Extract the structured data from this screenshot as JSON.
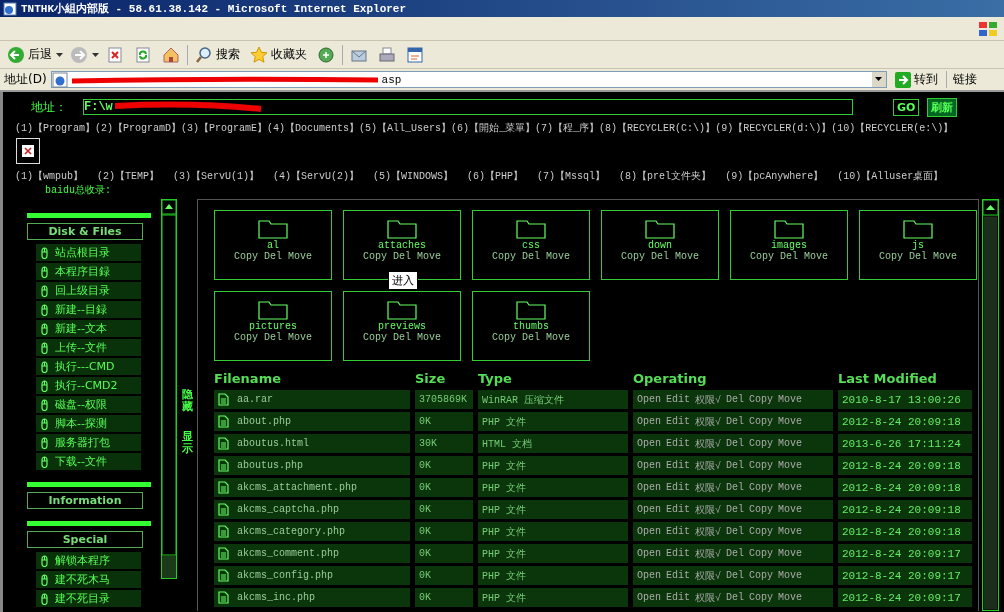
{
  "window": {
    "title": "TNTHK小組内部版 - 58.61.38.142 - Microsoft Internet Explorer"
  },
  "toolbar": [
    {
      "kind": "back",
      "label": "后退"
    },
    {
      "kind": "caret"
    },
    {
      "kind": "forward"
    },
    {
      "kind": "caret"
    },
    {
      "kind": "stop"
    },
    {
      "kind": "refresh"
    },
    {
      "kind": "home"
    },
    {
      "kind": "sep"
    },
    {
      "kind": "search",
      "label": "搜索"
    },
    {
      "kind": "favorites",
      "label": "收藏夹"
    },
    {
      "kind": "media"
    },
    {
      "kind": "sep"
    },
    {
      "kind": "mail"
    },
    {
      "kind": "print"
    },
    {
      "kind": "edit"
    }
  ],
  "address_bar": {
    "label": "地址(D)",
    "url": "asp",
    "go": "转到",
    "links": "链接"
  },
  "shell": {
    "path_label": "地址：",
    "path": "F:\\w",
    "go": "GO",
    "refresh": "刷新"
  },
  "quick_links": [
    "(1)【Program】",
    "(2)【ProgramD】",
    "(3)【ProgramE】",
    "(4)【Documents】",
    "(5)【All_Users】",
    "(6)【開始_菜單】",
    "(7)【程_序】",
    "(8)【RECYCLER(C:\\)】",
    "(9)【RECYCLER(d:\\)】",
    "(10)【RECYCLER(e:\\)】"
  ],
  "quick_links_2": [
    "(1)【wmpub】",
    "(2)【TEMP】",
    "(3)【ServU(1)】",
    "(4)【ServU(2)】",
    "(5)【WINDOWS】",
    "(6)【PHP】",
    "(7)【Mssql】",
    "(8)【prel文件夹】",
    "(9)【pcAnywhere】",
    "(10)【Alluser桌面】"
  ],
  "baidu": "baidu总收录:",
  "sidebar": {
    "sections": [
      {
        "title": "Disk & Files",
        "items": [
          "站点根目录",
          "本程序目録",
          "回上级目录",
          "新建--目録",
          "新建--文本",
          "上传--文件",
          "执行---CMD",
          "执行--CMD2",
          "磁盘--权限",
          "脚本--探测",
          "服务器打包",
          "下载--文件"
        ]
      },
      {
        "title": "Information"
      },
      {
        "title": "Special",
        "items": [
          "解锁本程序",
          "建不死木马",
          "建不死目录"
        ]
      }
    ],
    "toggle": [
      "隐藏",
      "显示"
    ]
  },
  "folders": [
    {
      "name": "al",
      "actions": [
        "Copy",
        "Del",
        "Move"
      ]
    },
    {
      "name": "attaches",
      "actions": [
        "Copy",
        "Del",
        "Move"
      ],
      "tooltip": "进入"
    },
    {
      "name": "css",
      "actions": [
        "Copy",
        "Del",
        "Move"
      ]
    },
    {
      "name": "down",
      "actions": [
        "Copy",
        "Del",
        "Move"
      ]
    },
    {
      "name": "images",
      "actions": [
        "Copy",
        "Del",
        "Move"
      ]
    },
    {
      "name": "js",
      "actions": [
        "Copy",
        "Del",
        "Move"
      ]
    },
    {
      "name": "pictures",
      "actions": [
        "Copy",
        "Del",
        "Move"
      ]
    },
    {
      "name": "previews",
      "actions": [
        "Copy",
        "Del",
        "Move"
      ]
    },
    {
      "name": "thumbs",
      "actions": [
        "Copy",
        "Del",
        "Move"
      ]
    }
  ],
  "files": {
    "columns": [
      "Filename",
      "Size",
      "Type",
      "Operating",
      "Last Modified"
    ],
    "rows": [
      {
        "name": "aa.rar",
        "size": "3705869K",
        "type": "WinRAR 压缩文件",
        "operations": [
          "Open",
          "Edit",
          "权限√",
          "Del",
          "Copy",
          "Move"
        ],
        "modified": "2010-8-17 13:00:26"
      },
      {
        "name": "about.php",
        "size": "0K",
        "type": "PHP 文件",
        "operations": [
          "Open",
          "Edit",
          "权限√",
          "Del",
          "Copy",
          "Move"
        ],
        "modified": "2012-8-24 20:09:18"
      },
      {
        "name": "aboutus.html",
        "size": "30K",
        "type": "HTML 文档",
        "operations": [
          "Open",
          "Edit",
          "权限√",
          "Del",
          "Copy",
          "Move"
        ],
        "modified": "2013-6-26 17:11:24"
      },
      {
        "name": "aboutus.php",
        "size": "0K",
        "type": "PHP 文件",
        "operations": [
          "Open",
          "Edit",
          "权限√",
          "Del",
          "Copy",
          "Move"
        ],
        "modified": "2012-8-24 20:09:18"
      },
      {
        "name": "akcms_attachment.php",
        "size": "0K",
        "type": "PHP 文件",
        "operations": [
          "Open",
          "Edit",
          "权限√",
          "Del",
          "Copy",
          "Move"
        ],
        "modified": "2012-8-24 20:09:18"
      },
      {
        "name": "akcms_captcha.php",
        "size": "0K",
        "type": "PHP 文件",
        "operations": [
          "Open",
          "Edit",
          "权限√",
          "Del",
          "Copy",
          "Move"
        ],
        "modified": "2012-8-24 20:09:18"
      },
      {
        "name": "akcms_category.php",
        "size": "0K",
        "type": "PHP 文件",
        "operations": [
          "Open",
          "Edit",
          "权限√",
          "Del",
          "Copy",
          "Move"
        ],
        "modified": "2012-8-24 20:09:18"
      },
      {
        "name": "akcms_comment.php",
        "size": "0K",
        "type": "PHP 文件",
        "operations": [
          "Open",
          "Edit",
          "权限√",
          "Del",
          "Copy",
          "Move"
        ],
        "modified": "2012-8-24 20:09:17"
      },
      {
        "name": "akcms_config.php",
        "size": "0K",
        "type": "PHP 文件",
        "operations": [
          "Open",
          "Edit",
          "权限√",
          "Del",
          "Copy",
          "Move"
        ],
        "modified": "2012-8-24 20:09:17"
      },
      {
        "name": "akcms_inc.php",
        "size": "0K",
        "type": "PHP 文件",
        "operations": [
          "Open",
          "Edit",
          "权限√",
          "Del",
          "Copy",
          "Move"
        ],
        "modified": "2012-8-24 20:09:17"
      }
    ]
  }
}
